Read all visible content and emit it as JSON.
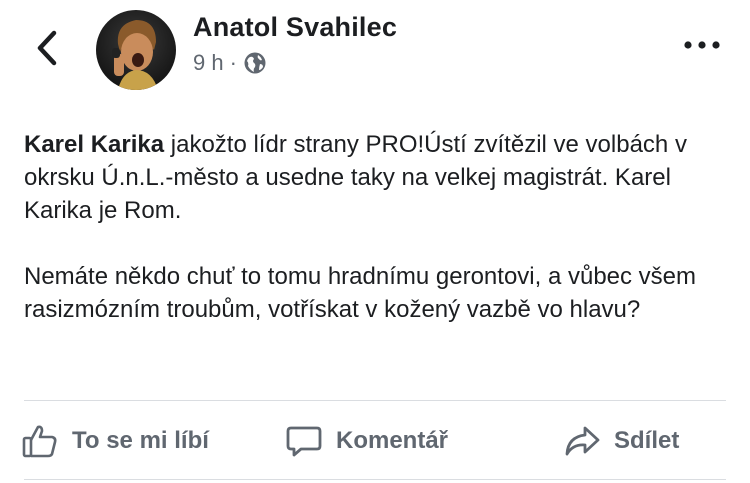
{
  "header": {
    "back_icon": "chevron-left-icon",
    "author_name": "Anatol Svahilec",
    "time": "9 h",
    "separator": "·",
    "privacy_icon": "globe-icon",
    "more_icon": "more-horizontal-icon"
  },
  "post": {
    "mention": "Karel Karika",
    "paragraph1_rest": " jakožto lídr strany PRO!Ústí zvítězil ve volbách v okrsku Ú.n.L.-město a usedne taky na velkej magistrát. Karel Karika je Rom.",
    "paragraph2": "Nemáte někdo chuť to tomu hradnímu gerontovi, a vůbec všem rasizmózním troubům, votřískat v kožený vazbě vo hlavu?"
  },
  "actions": {
    "like_label": "To se mi líbí",
    "like_icon": "thumbs-up-icon",
    "comment_label": "Komentář",
    "comment_icon": "comment-icon",
    "share_label": "Sdílet",
    "share_icon": "share-icon"
  },
  "colors": {
    "text": "#1c1e21",
    "secondary": "#606770",
    "divider": "#dadde1"
  }
}
